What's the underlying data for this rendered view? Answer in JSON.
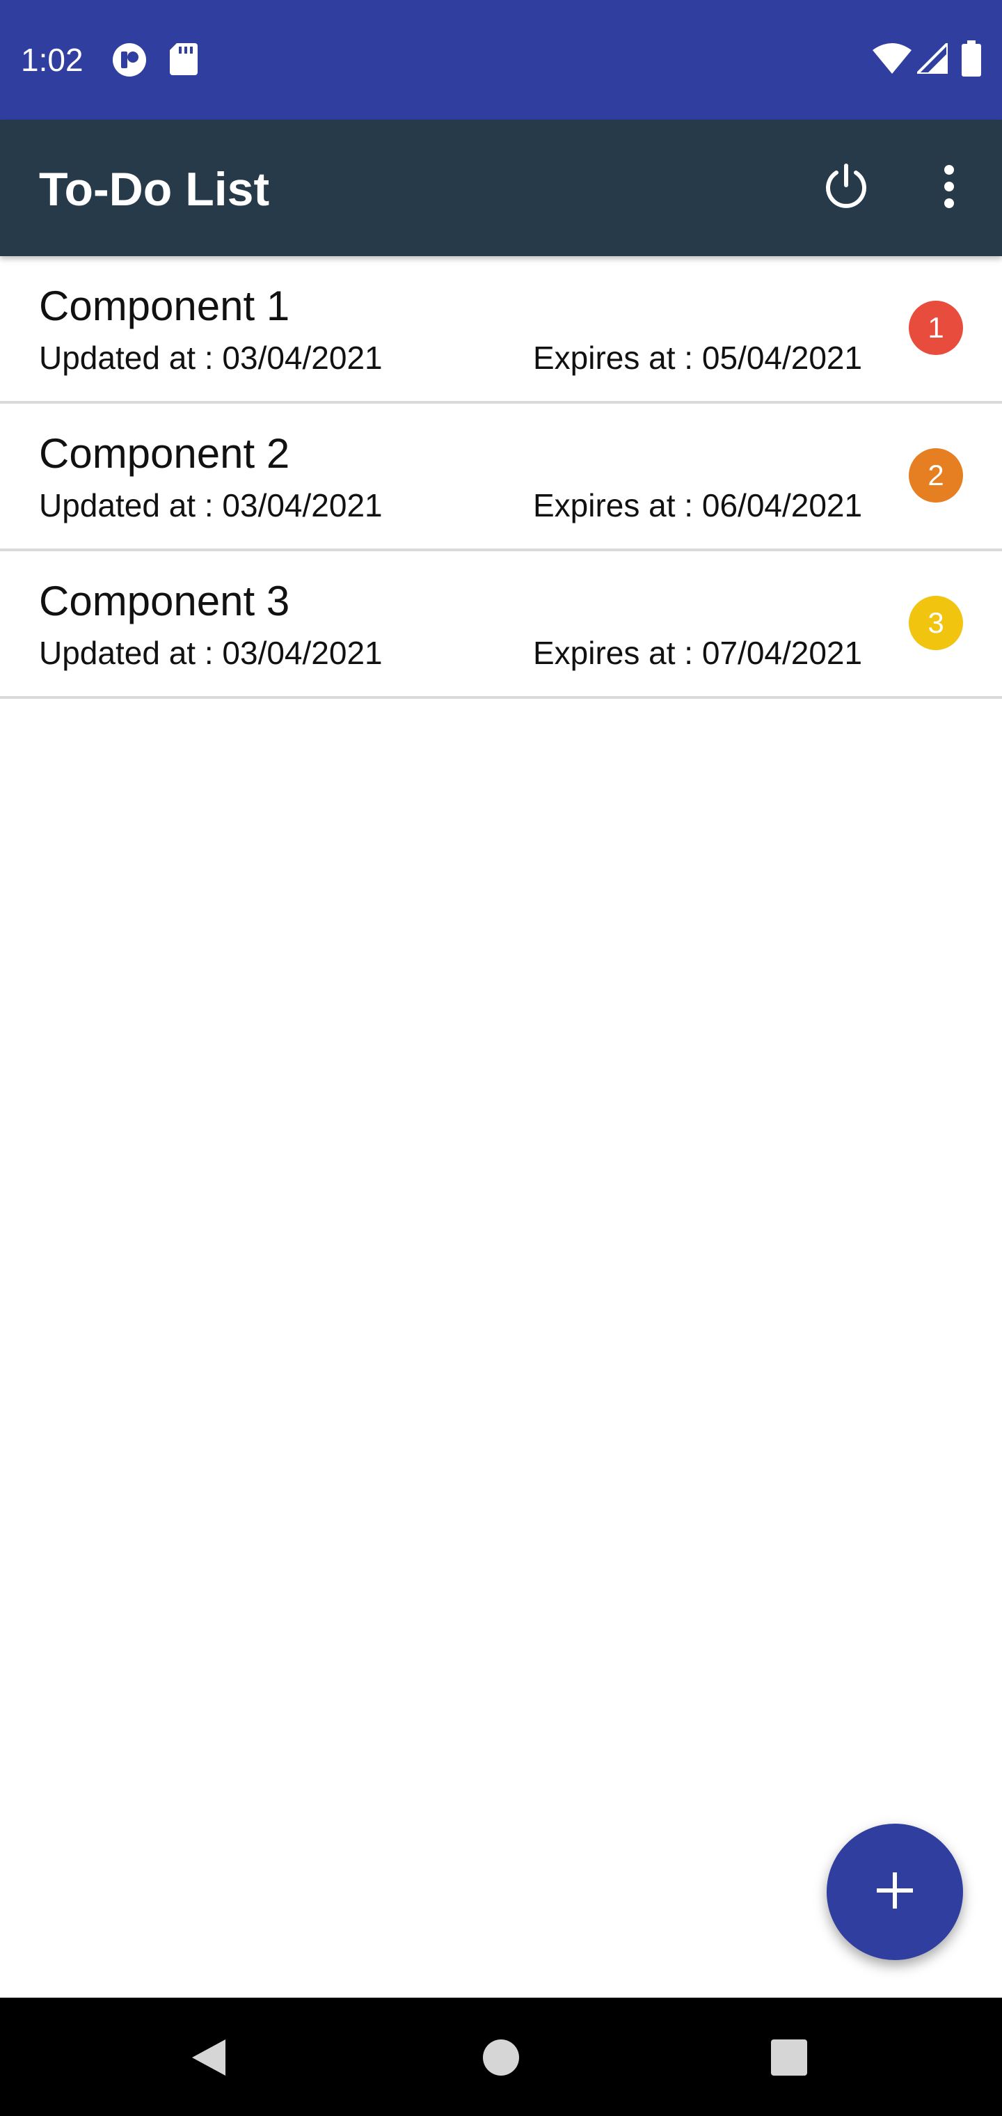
{
  "status_bar": {
    "time": "1:02",
    "background": "#303F9F",
    "left_icons": [
      "media-icon",
      "sd-card-icon"
    ],
    "right_icons": [
      "wifi-icon",
      "cell-signal-icon",
      "battery-icon"
    ]
  },
  "app_bar": {
    "title": "To-Do List",
    "background": "#263A4A",
    "actions": [
      "power-icon",
      "more-vert-icon"
    ]
  },
  "todo_items": [
    {
      "title": "Component 1",
      "updated": "Updated at : 03/04/2021",
      "expires": "Expires at : 05/04/2021",
      "priority": "1",
      "priority_color": "#E84C3D"
    },
    {
      "title": "Component 2",
      "updated": "Updated at : 03/04/2021",
      "expires": "Expires at : 06/04/2021",
      "priority": "2",
      "priority_color": "#E67E22"
    },
    {
      "title": "Component 3",
      "updated": "Updated at : 03/04/2021",
      "expires": "Expires at : 07/04/2021",
      "priority": "3",
      "priority_color": "#F1C40F"
    }
  ],
  "fab": {
    "icon": "plus-icon",
    "color": "#303F9F"
  },
  "nav_bar": {
    "buttons": [
      "back-icon",
      "home-icon",
      "recents-icon"
    ]
  }
}
